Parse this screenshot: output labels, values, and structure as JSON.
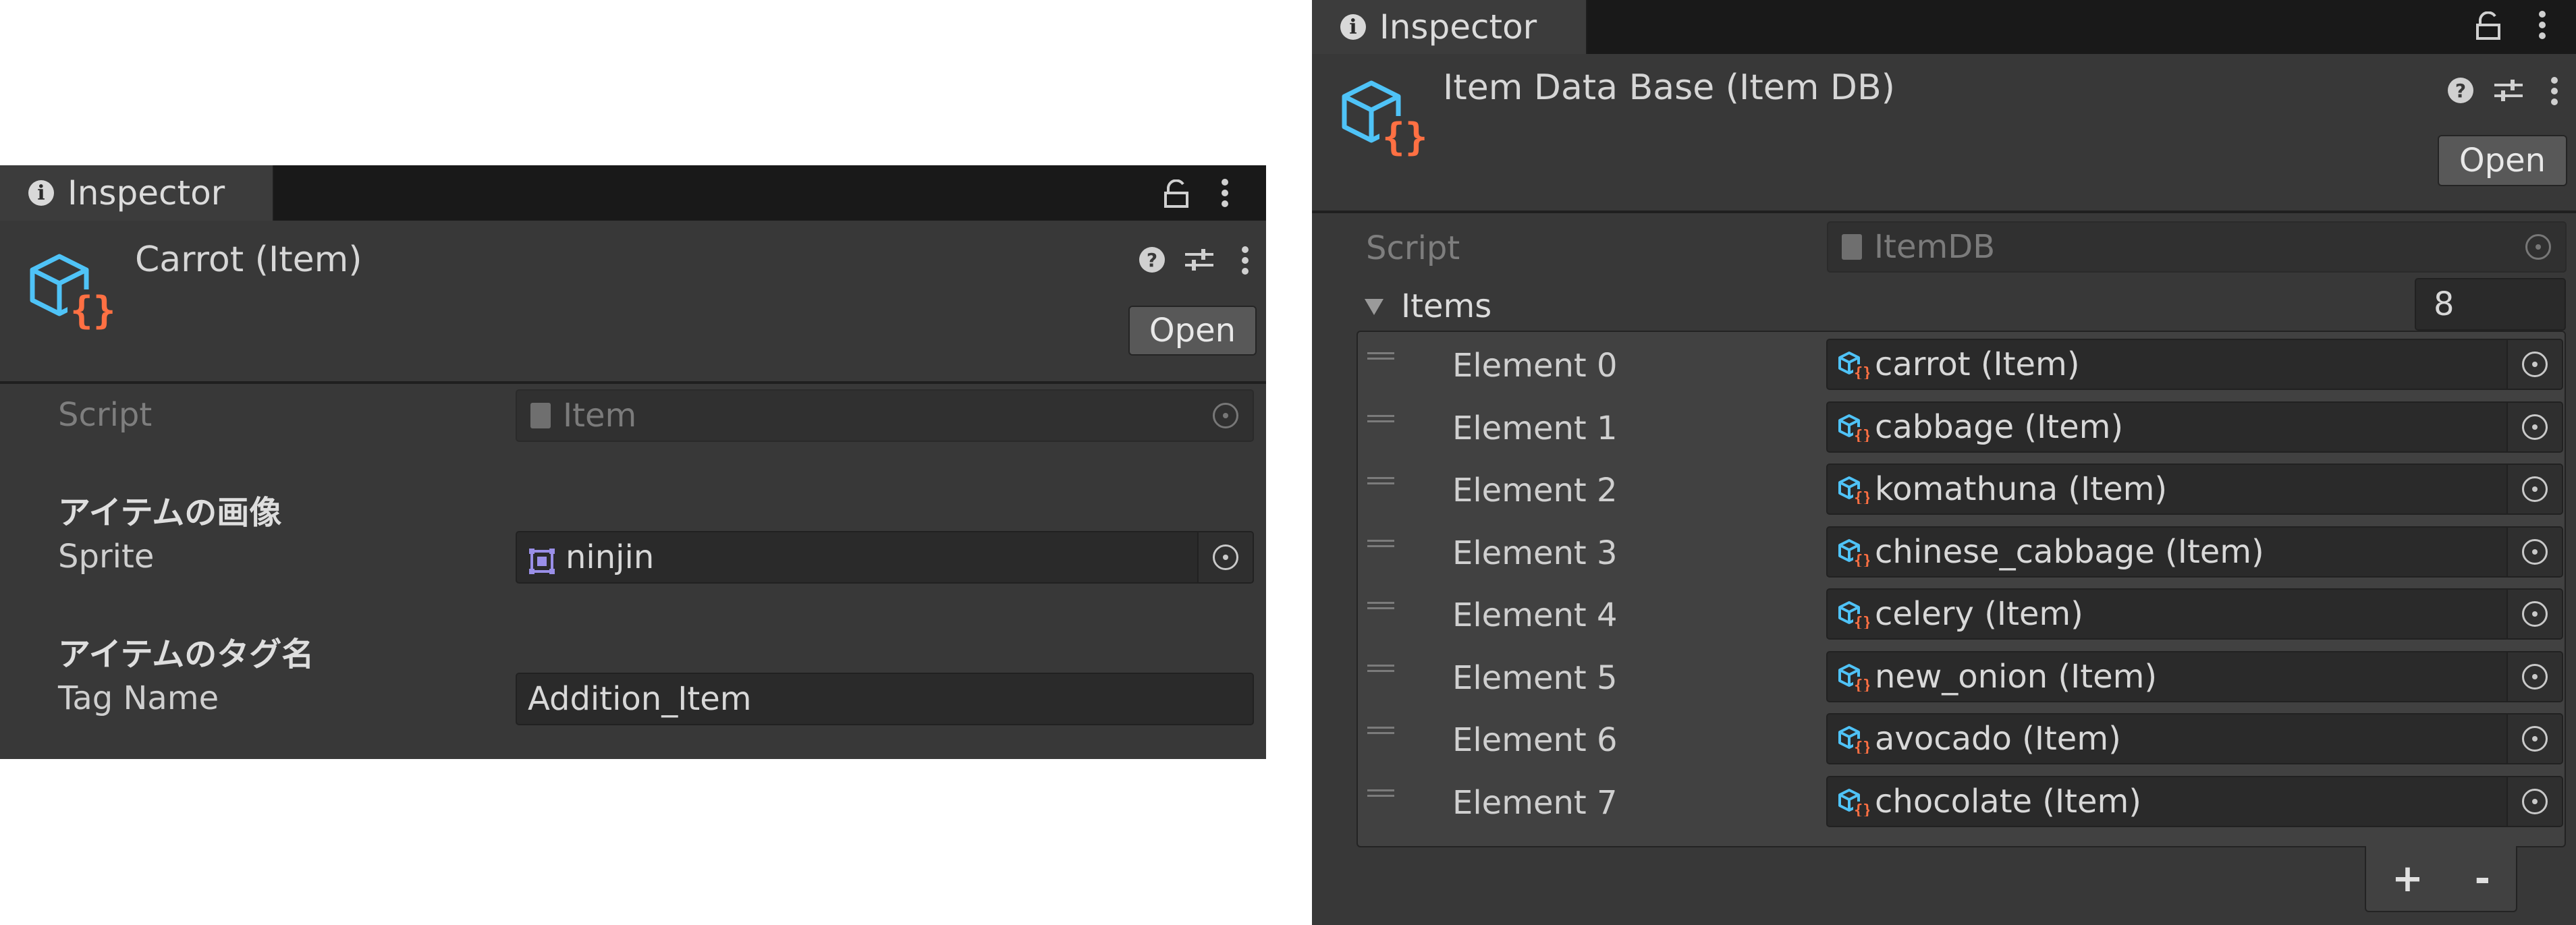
{
  "colors": {
    "panel_bg": "#383838",
    "tabbar_bg": "#191919",
    "field_bg": "#2a2a2a",
    "icon_blue": "#4fc3f7",
    "icon_orange": "#ff7043",
    "sprite_icon_purple": "#9a8fe8"
  },
  "left_inspector": {
    "tab_label": "Inspector",
    "title": "Carrot (Item)",
    "open_button": "Open",
    "script_label": "Script",
    "script_value": "Item",
    "sprite_header": "アイテムの画像",
    "sprite_label": "Sprite",
    "sprite_value": "ninjin",
    "tag_header": "アイテムのタグ名",
    "tag_label": "Tag Name",
    "tag_value": "Addition_Item"
  },
  "right_inspector": {
    "tab_label": "Inspector",
    "title": "Item Data Base (Item DB)",
    "open_button": "Open",
    "script_label": "Script",
    "script_value": "ItemDB",
    "items_label": "Items",
    "items_count": "8",
    "elements": [
      {
        "label": "Element 0",
        "value": "carrot (Item)"
      },
      {
        "label": "Element 1",
        "value": "cabbage (Item)"
      },
      {
        "label": "Element 2",
        "value": "komathuna (Item)"
      },
      {
        "label": "Element 3",
        "value": "chinese_cabbage (Item)"
      },
      {
        "label": "Element 4",
        "value": "celery (Item)"
      },
      {
        "label": "Element 5",
        "value": "new_onion (Item)"
      },
      {
        "label": "Element 6",
        "value": "avocado (Item)"
      },
      {
        "label": "Element 7",
        "value": "chocolate (Item)"
      }
    ],
    "add_button": "+",
    "remove_button": "-"
  }
}
